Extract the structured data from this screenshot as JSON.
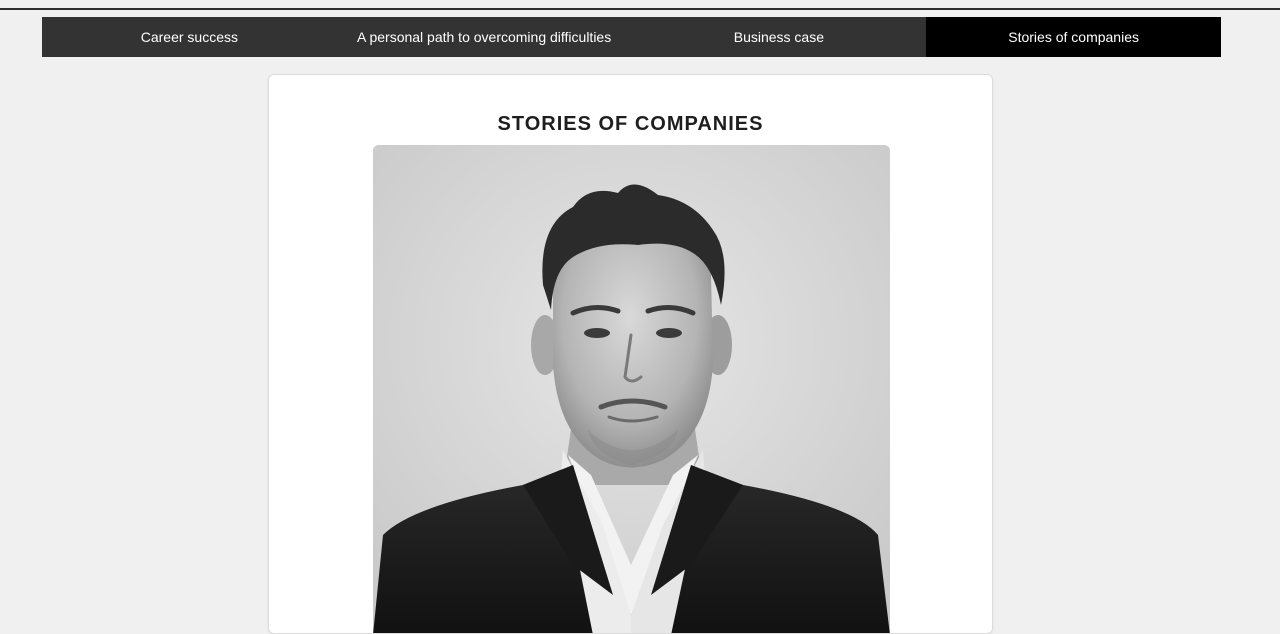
{
  "nav": {
    "items": [
      {
        "label": "Career success",
        "active": false
      },
      {
        "label": "A personal path to overcoming difficulties",
        "active": false
      },
      {
        "label": "Business case",
        "active": false
      },
      {
        "label": "Stories of companies",
        "active": true
      }
    ]
  },
  "main": {
    "title": "STORIES OF COMPANIES",
    "image": {
      "subject": "black-and-white portrait of a man in a dark suit and white open-collar shirt"
    }
  },
  "colors": {
    "nav_background": "#333333",
    "nav_active_background": "#000000",
    "nav_text": "#ffffff",
    "page_background": "#f0f0f0",
    "card_background": "#ffffff"
  }
}
